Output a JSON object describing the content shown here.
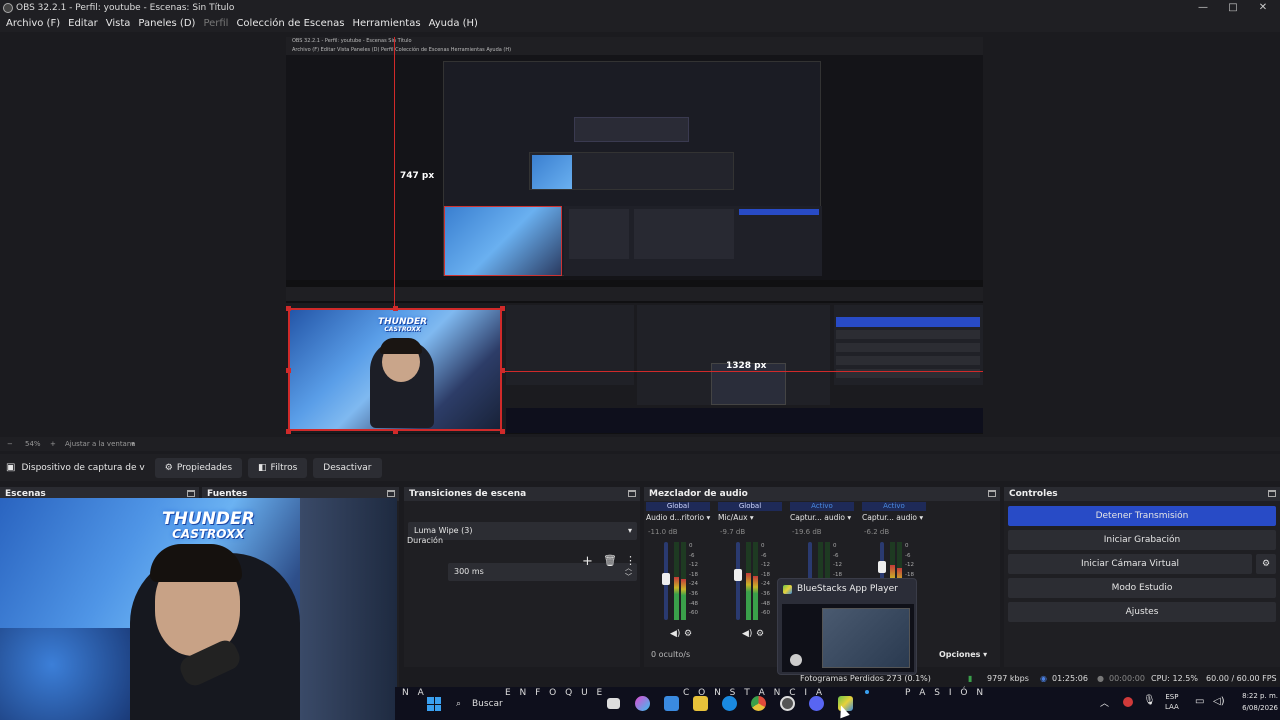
{
  "window": {
    "title": "OBS 32.2.1 - Perfil: youtube - Escenas: Sin Título",
    "minimize": "—",
    "maximize": "□",
    "close": "✕"
  },
  "menu": {
    "items": [
      "Archivo (F)",
      "Editar",
      "Vista",
      "Paneles (D)",
      "Perfil",
      "Colección de Escenas",
      "Herramientas",
      "Ayuda (H)"
    ]
  },
  "preview": {
    "height_label": "747 px",
    "width_label": "1328 px",
    "nested_title": "OBS 32.2.1 - Perfil: youtube - Escenas Sin Título",
    "nested_menu": "Archivo (F)   Editar   Vista   Paneles (D)   Perfil   Colección de Escenas   Herramientas   Ayuda (H)",
    "logo_line1": "THUNDER",
    "logo_line2": "CASTROXX"
  },
  "zoom": {
    "minus": "−",
    "level": "54%",
    "plus": "+",
    "fit_label": "Ajustar a la ventana"
  },
  "source_toolbar": {
    "source_name": "Dispositivo de captura de v",
    "properties": "Propiedades",
    "filters": "Filtros",
    "deactivate": "Desactivar"
  },
  "docks": {
    "scenes": {
      "title": "Escenas"
    },
    "sources": {
      "title": "Fuentes"
    },
    "transitions": {
      "title": "Transiciones de escena",
      "selected": "Luma Wipe (3)",
      "duration_label": "Duración",
      "duration_value": "300 ms"
    },
    "mixer": {
      "title": "Mezclador de audio",
      "channels": [
        {
          "badge": "Global",
          "name": "Audio d...ritorio",
          "db": "-11.0 dB",
          "level": 0.55
        },
        {
          "badge": "Global",
          "name": "Mic/Aux",
          "db": "-9.7 dB",
          "level": 0.6
        },
        {
          "badge": "Activo",
          "name": "Captur... audio",
          "db": "-19.6 dB",
          "level": 0.35
        },
        {
          "badge": "Activo",
          "name": "Captur... audio",
          "db": "-6.2 dB",
          "level": 0.7
        }
      ],
      "scale": [
        "0",
        "-6",
        "-12",
        "-18",
        "-24",
        "-36",
        "-48",
        "-60"
      ],
      "hidden": "0 oculto/s",
      "options": "Opciones"
    },
    "controls": {
      "title": "Controles",
      "stop_stream": "Detener Transmisión",
      "start_recording": "Iniciar Grabación",
      "start_virtual_cam": "Iniciar Cámara Virtual",
      "studio_mode": "Modo Estudio",
      "settings": "Ajustes"
    }
  },
  "popup": {
    "title": "BlueStacks App Player"
  },
  "status": {
    "frames": "Fotogramas Perdidos 273 (0.1%)",
    "bitrate": "9797 kbps",
    "stream_time": "01:25:06",
    "rec_time": "00:00:00",
    "cpu": "CPU: 12.5%",
    "fps": "60.00 / 60.00 FPS"
  },
  "taskbar": {
    "search": "Buscar",
    "wallpaper_words": [
      "N A",
      "E N F O Q U E",
      "C O N S T A N C I A",
      "P A S I Ó N"
    ],
    "lang1": "ESP",
    "lang2": "LAA",
    "time": "8:22 p. m.",
    "date": "6/08/2026"
  }
}
